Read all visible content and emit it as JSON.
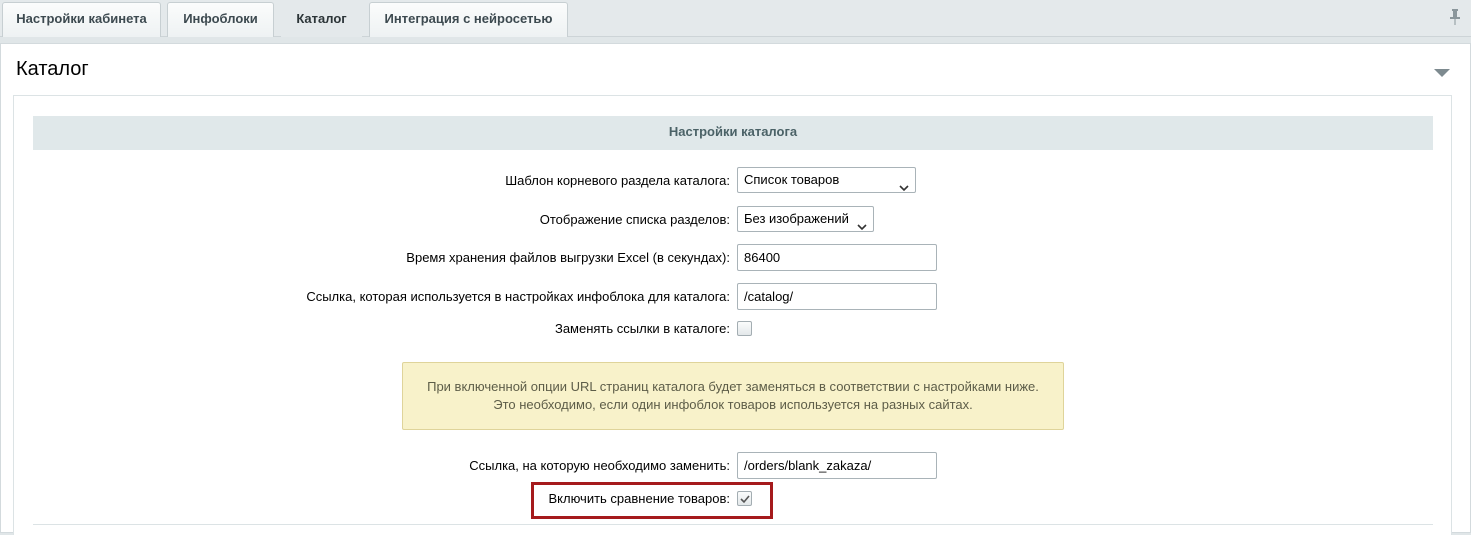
{
  "tabs": [
    {
      "label": "Настройки кабинета",
      "active": false
    },
    {
      "label": "Инфоблоки",
      "active": false
    },
    {
      "label": "Каталог",
      "active": true
    },
    {
      "label": "Интеграция с нейросетью",
      "active": false
    }
  ],
  "icons": {
    "pin": "pin-icon",
    "collapse": "collapse-arrow-icon",
    "chevron": "chevron-down-icon",
    "check": "check-icon"
  },
  "panel": {
    "title": "Каталог",
    "section_title": "Настройки каталога"
  },
  "fields": {
    "root_template": {
      "label": "Шаблон корневого раздела каталога:",
      "value": "Список товаров"
    },
    "sections_display": {
      "label": "Отображение списка разделов:",
      "value": "Без изображений"
    },
    "excel_ttl": {
      "label": "Время хранения файлов выгрузки Excel (в секундах):",
      "value": "86400"
    },
    "catalog_link": {
      "label": "Ссылка, которая используется в настройках инфоблока для каталога:",
      "value": "/catalog/"
    },
    "replace_links": {
      "label": "Заменять ссылки в каталоге:",
      "checked": false
    },
    "replace_target": {
      "label": "Ссылка, на которую необходимо заменить:",
      "value": "/orders/blank_zakaza/"
    },
    "enable_compare": {
      "label": "Включить сравнение товаров:",
      "checked": true
    }
  },
  "notice": {
    "line1": "При включенной опции URL страниц каталога будет заменяться в соответствии с настройками ниже.",
    "line2": "Это необходимо, если один инфоблок товаров используется на разных сайтах."
  },
  "colors": {
    "highlight": "#a51a1c",
    "notice_bg": "#f8f2ca",
    "section_bg": "#e0e8ea"
  }
}
